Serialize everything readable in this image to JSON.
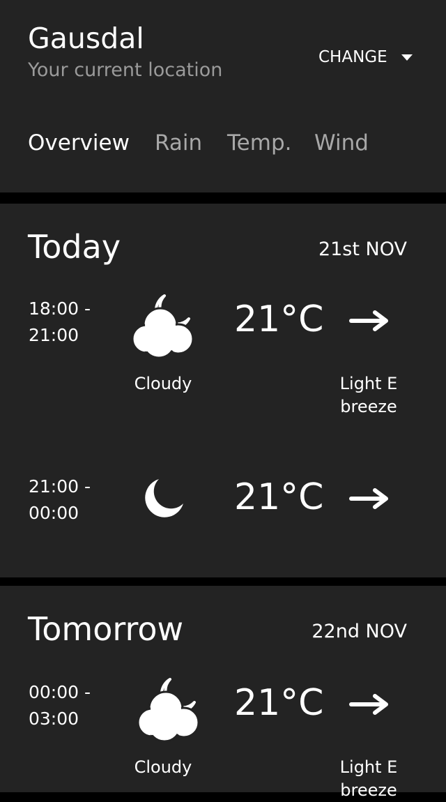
{
  "location": {
    "name": "Gausdal",
    "subtitle": "Your current location",
    "change_label": "CHANGE"
  },
  "tabs": [
    {
      "label": "Overview",
      "active": true
    },
    {
      "label": "Rain",
      "active": false
    },
    {
      "label": "Temp.",
      "active": false
    },
    {
      "label": "Wind",
      "active": false
    }
  ],
  "days": [
    {
      "title": "Today",
      "date": "21st NOV",
      "periods": [
        {
          "start": "18:00 -",
          "end": "21:00",
          "icon": "cloud-moon-icon",
          "temperature": "21°C",
          "wind_icon": "arrow-right-icon",
          "condition": "Cloudy",
          "wind_line1": "Light E",
          "wind_line2": "breeze"
        },
        {
          "start": "21:00 -",
          "end": "00:00",
          "icon": "moon-icon",
          "temperature": "21°C",
          "wind_icon": "arrow-right-icon",
          "condition": "",
          "wind_line1": "",
          "wind_line2": ""
        }
      ]
    },
    {
      "title": "Tomorrow",
      "date": "22nd NOV",
      "periods": [
        {
          "start": "00:00 -",
          "end": "03:00",
          "icon": "cloud-moon-icon",
          "temperature": "21°C",
          "wind_icon": "arrow-right-icon",
          "condition": "Cloudy",
          "wind_line1": "Light E",
          "wind_line2": "breeze"
        }
      ]
    }
  ],
  "colors": {
    "background": "#000000",
    "panel": "#232323",
    "text": "#ffffff",
    "muted": "#9a9a9a"
  }
}
